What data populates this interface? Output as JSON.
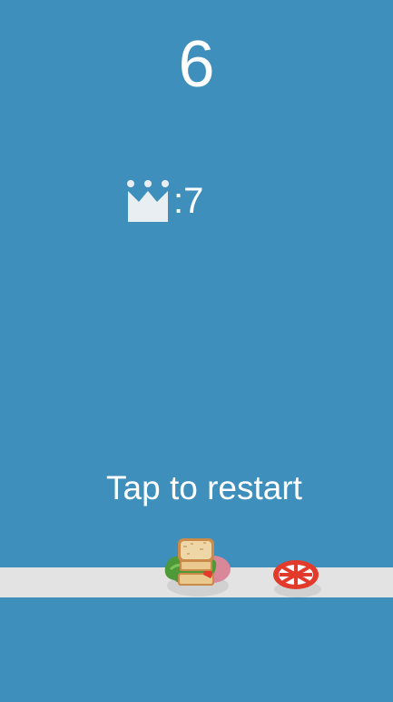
{
  "game": {
    "score": "6",
    "best": {
      "icon": "crown-icon",
      "separator": ":",
      "value": "7"
    },
    "restart_label": "Tap to restart",
    "items": {
      "player": "sandwich-icon",
      "obstacle": "tomato-slice-icon"
    }
  },
  "colors": {
    "background": "#3f8fbc",
    "track": "#e3e3e3",
    "text": "#ffffff",
    "crown": "#e8eef2",
    "tomato": "#e23a2b"
  }
}
